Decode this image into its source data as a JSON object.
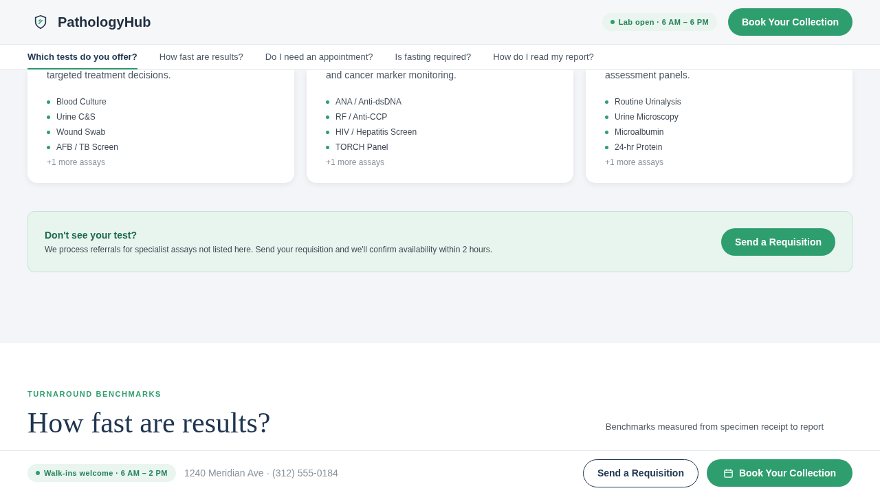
{
  "header": {
    "brand": "PathologyHub",
    "status": "Lab open · 6 AM – 6 PM",
    "cta": "Book Your Collection"
  },
  "nav": [
    {
      "label": "Which tests do you offer?",
      "selected": true
    },
    {
      "label": "How fast are results?",
      "selected": false
    },
    {
      "label": "Do I need an appointment?",
      "selected": false
    },
    {
      "label": "Is fasting required?",
      "selected": false
    },
    {
      "label": "How do I read my report?",
      "selected": false
    }
  ],
  "cards": [
    {
      "description": "targeted treatment decisions.",
      "tests": [
        "Blood Culture",
        "Urine C&S",
        "Wound Swab",
        "AFB / TB Screen"
      ],
      "more": "+1 more assays"
    },
    {
      "description": "and cancer marker monitoring.",
      "tests": [
        "ANA / Anti-dsDNA",
        "RF / Anti-CCP",
        "HIV / Hepatitis Screen",
        "TORCH Panel"
      ],
      "more": "+1 more assays"
    },
    {
      "description": "assessment panels.",
      "tests": [
        "Routine Urinalysis",
        "Urine Microscopy",
        "Microalbumin",
        "24-hr Protein"
      ],
      "more": "+1 more assays"
    }
  ],
  "banner": {
    "title": "Don't see your test?",
    "text": "We process referrals for specialist assays not listed here. Send your requisition and we'll confirm availability within 2 hours.",
    "button": "Send a Requisition"
  },
  "section": {
    "eyebrow": "TURNAROUND BENCHMARKS",
    "heading": "How fast are results?",
    "intro": "Benchmarks measured from specimen receipt to report"
  },
  "footer": {
    "status": "Walk-ins welcome · 6 AM – 2 PM",
    "contact": "1240 Meridian Ave · (312) 555-0184",
    "secondary": "Send a Requisition",
    "primary": "Book Your Collection"
  }
}
